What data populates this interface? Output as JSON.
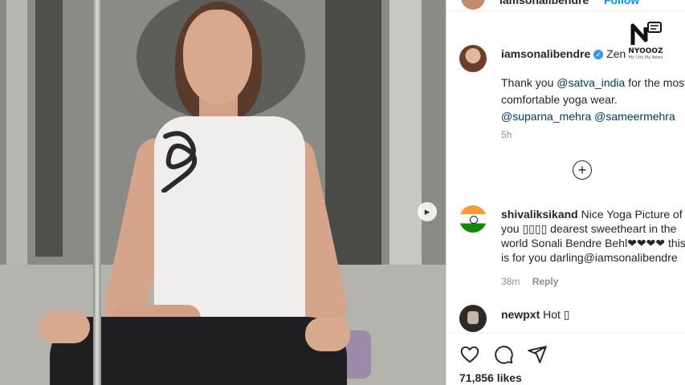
{
  "header": {
    "username": "iamsonalibendre",
    "follow_label": "Follow"
  },
  "post": {
    "author": "iamsonalibendre",
    "author_suffix": "Zen",
    "caption_prefix": "Thank you ",
    "mention_1": "@satva_india",
    "caption_middle": " for the most comfortable yoga wear.",
    "mention_2": "@suparna_mehra",
    "mention_3": "@sameermehra",
    "time": "5h",
    "load_more_icon": "plus-circle-icon",
    "likes": "71,856 likes"
  },
  "comments": [
    {
      "username": "shivaliksikand",
      "text": "Nice Yoga Picture of you ▯▯▯▯ dearest sweetheart in the world Sonali Bendre Behl❤❤❤❤ this is for you darling@iamsonalibendre",
      "time": "38m",
      "reply_label": "Reply"
    },
    {
      "username": "newpxt",
      "text": "Hot ▯"
    }
  ],
  "actions": [
    "heart-icon",
    "comment-icon",
    "share-icon"
  ],
  "watermark": {
    "brand": "NYOOOZ",
    "tagline": "My City My News"
  },
  "colors": {
    "link": "#00376b",
    "verified": "#3897f0",
    "follow": "#0095f6",
    "muted": "#8e8e8e"
  }
}
